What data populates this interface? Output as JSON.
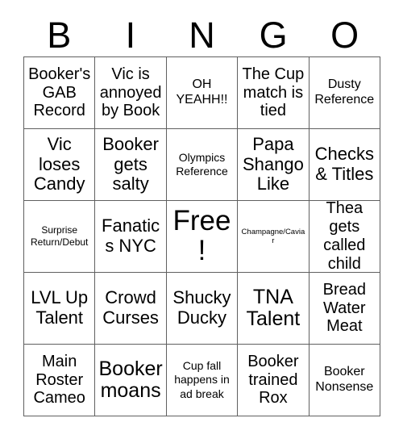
{
  "card": {
    "title": "BINGO",
    "header_letters": [
      "B",
      "I",
      "N",
      "G",
      "O"
    ],
    "columns": 5,
    "rows": 5,
    "colors": {
      "background": "#ffffff",
      "cell_background": "#ffffff",
      "grid_line": "#606060",
      "text": "#000000"
    },
    "cells": [
      {
        "text": "Booker's GAB Record",
        "size": "md",
        "column": "B",
        "row": 1,
        "free": false
      },
      {
        "text": "Vic is annoyed by Book",
        "size": "md",
        "column": "I",
        "row": 1,
        "free": false
      },
      {
        "text": "OH YEAHH!!",
        "size": "sm",
        "column": "N",
        "row": 1,
        "free": false
      },
      {
        "text": "The Cup match is tied",
        "size": "md",
        "column": "G",
        "row": 1,
        "free": false
      },
      {
        "text": "Dusty Reference",
        "size": "sm",
        "column": "O",
        "row": 1,
        "free": false
      },
      {
        "text": "Vic loses Candy",
        "size": "lg",
        "column": "B",
        "row": 2,
        "free": false
      },
      {
        "text": "Booker gets salty",
        "size": "lg",
        "column": "I",
        "row": 2,
        "free": false
      },
      {
        "text": "Olympics Reference",
        "size": "xs",
        "column": "N",
        "row": 2,
        "free": false
      },
      {
        "text": "Papa Shango Like",
        "size": "lg",
        "column": "G",
        "row": 2,
        "free": false
      },
      {
        "text": "Checks & Titles",
        "size": "lg",
        "column": "O",
        "row": 2,
        "free": false
      },
      {
        "text": "Surprise Return/Debut",
        "size": "xxs",
        "column": "B",
        "row": 3,
        "free": false
      },
      {
        "text": "Fanatics NYC",
        "size": "lg",
        "column": "I",
        "row": 3,
        "free": false
      },
      {
        "text": "Free!",
        "size": "xxl",
        "column": "N",
        "row": 3,
        "free": true
      },
      {
        "text": "Champagne/Caviar",
        "size": "tiny",
        "column": "G",
        "row": 3,
        "free": false
      },
      {
        "text": "Thea gets called child",
        "size": "md",
        "column": "O",
        "row": 3,
        "free": false
      },
      {
        "text": "LVL Up Talent",
        "size": "lg",
        "column": "B",
        "row": 4,
        "free": false
      },
      {
        "text": "Crowd Curses",
        "size": "lg",
        "column": "I",
        "row": 4,
        "free": false
      },
      {
        "text": "Shucky Ducky",
        "size": "lg",
        "column": "N",
        "row": 4,
        "free": false
      },
      {
        "text": "TNA Talent",
        "size": "xl",
        "column": "G",
        "row": 4,
        "free": false
      },
      {
        "text": "Bread Water Meat",
        "size": "md",
        "column": "O",
        "row": 4,
        "free": false
      },
      {
        "text": "Main Roster Cameo",
        "size": "md",
        "column": "B",
        "row": 5,
        "free": false
      },
      {
        "text": "Booker moans",
        "size": "xl",
        "column": "I",
        "row": 5,
        "free": false
      },
      {
        "text": "Cup fall happens in ad break",
        "size": "xs",
        "column": "N",
        "row": 5,
        "free": false
      },
      {
        "text": "Booker trained Rox",
        "size": "md",
        "column": "G",
        "row": 5,
        "free": false
      },
      {
        "text": "Booker Nonsense",
        "size": "sm",
        "column": "O",
        "row": 5,
        "free": false
      }
    ]
  }
}
